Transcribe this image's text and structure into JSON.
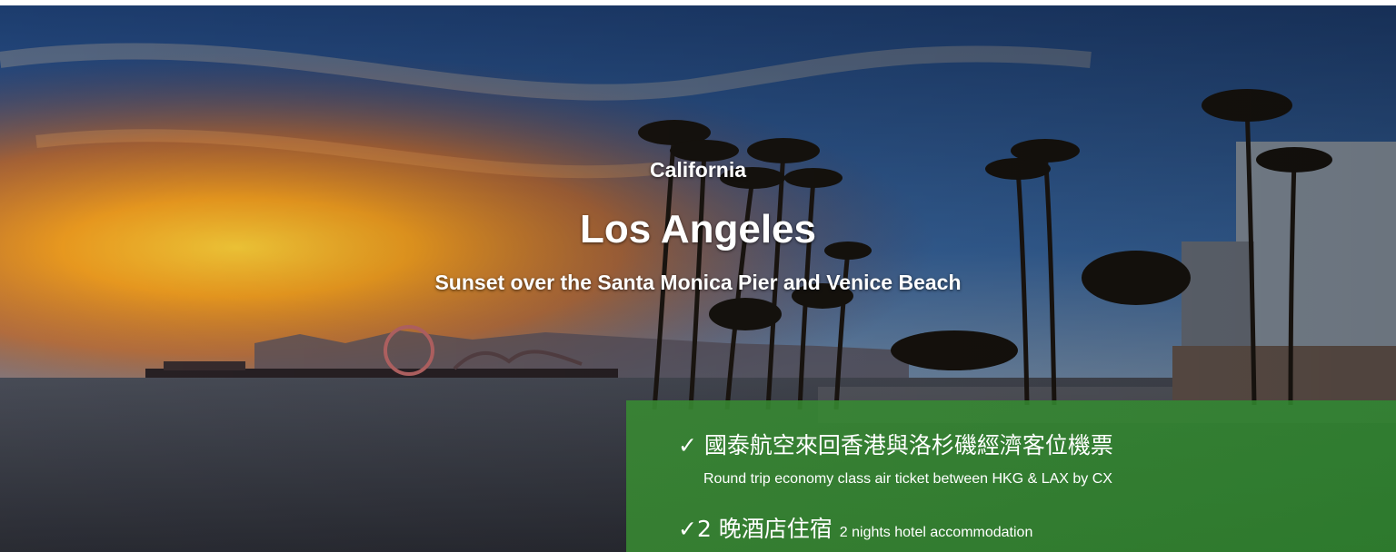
{
  "banner": {
    "region": "California",
    "city": "Los Angeles",
    "tagline": "Sunset over the Santa Monica Pier and Venice Beach"
  },
  "offer": {
    "check_symbol": "✓",
    "flight_zh": "國泰航空來回香港與洛杉磯經濟客位機票",
    "flight_en": "Round trip economy class air ticket between HKG & LAX by CX",
    "hotel_zh": "2 晚酒店住宿",
    "hotel_en": "2 nights hotel accommodation",
    "panel_color": "#388a32"
  }
}
